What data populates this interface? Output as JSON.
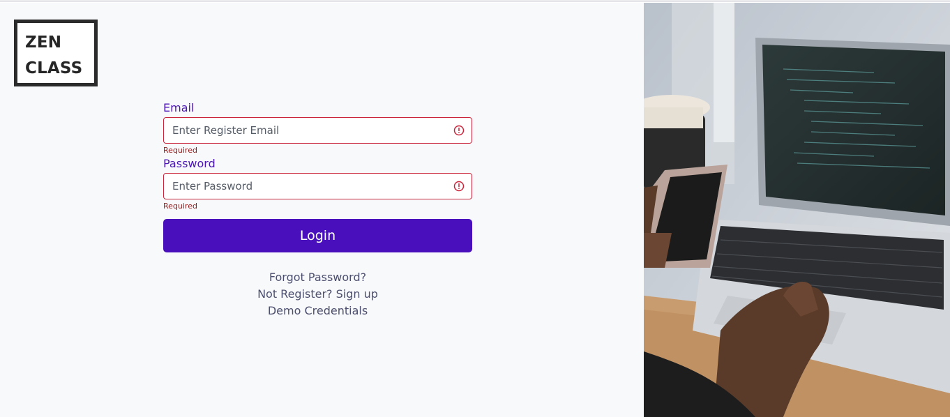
{
  "logo": {
    "line1": "ZEN",
    "line2": "CLASS"
  },
  "form": {
    "email": {
      "label": "Email",
      "placeholder": "Enter Register Email",
      "value": "",
      "error": "Required"
    },
    "password": {
      "label": "Password",
      "placeholder": "Enter Password",
      "value": "",
      "error": "Required"
    },
    "login_label": "Login"
  },
  "links": {
    "forgot": "Forgot Password?",
    "signup": "Not Register? Sign up",
    "demo": "Demo Credentials"
  },
  "hero_image": {
    "icon": "laptop-coding-photo"
  },
  "colors": {
    "primary": "#4a0fbd",
    "label": "#4a17b3",
    "error": "#c9243a",
    "error_text": "#8a1b1b",
    "link": "#4c4f6e",
    "background": "#f8f9fb"
  }
}
